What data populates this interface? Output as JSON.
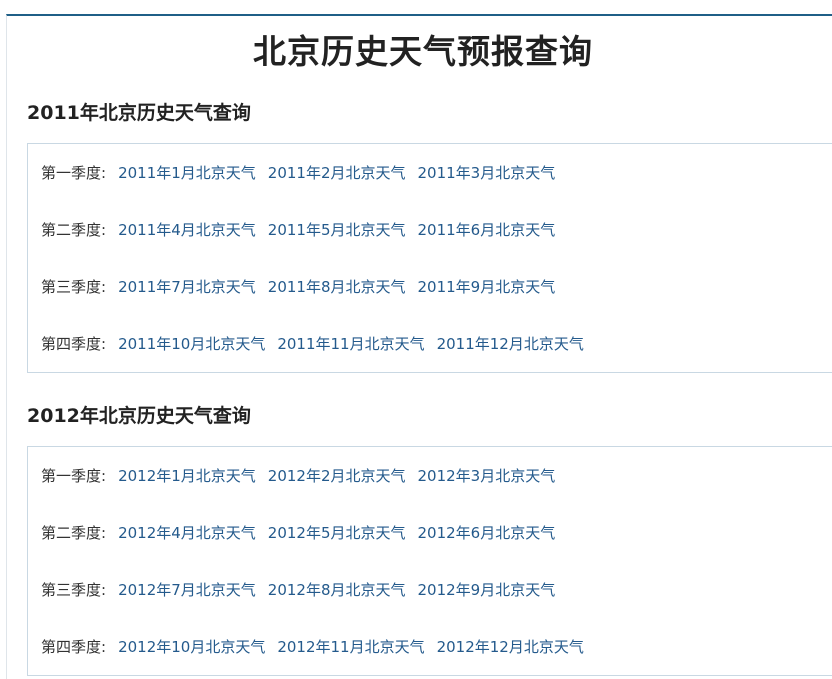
{
  "page_title": "北京历史天气预报查询",
  "sections": [
    {
      "heading": "2011年北京历史天气查询",
      "quarters": [
        {
          "label": "第一季度:",
          "months": [
            "2011年1月北京天气",
            "2011年2月北京天气",
            "2011年3月北京天气"
          ]
        },
        {
          "label": "第二季度:",
          "months": [
            "2011年4月北京天气",
            "2011年5月北京天气",
            "2011年6月北京天气"
          ]
        },
        {
          "label": "第三季度:",
          "months": [
            "2011年7月北京天气",
            "2011年8月北京天气",
            "2011年9月北京天气"
          ]
        },
        {
          "label": "第四季度:",
          "months": [
            "2011年10月北京天气",
            "2011年11月北京天气",
            "2011年12月北京天气"
          ]
        }
      ]
    },
    {
      "heading": "2012年北京历史天气查询",
      "quarters": [
        {
          "label": "第一季度:",
          "months": [
            "2012年1月北京天气",
            "2012年2月北京天气",
            "2012年3月北京天气"
          ]
        },
        {
          "label": "第二季度:",
          "months": [
            "2012年4月北京天气",
            "2012年5月北京天气",
            "2012年6月北京天气"
          ]
        },
        {
          "label": "第三季度:",
          "months": [
            "2012年7月北京天气",
            "2012年8月北京天气",
            "2012年9月北京天气"
          ]
        },
        {
          "label": "第四季度:",
          "months": [
            "2012年10月北京天气",
            "2012年11月北京天气",
            "2012年12月北京天气"
          ]
        }
      ]
    }
  ]
}
